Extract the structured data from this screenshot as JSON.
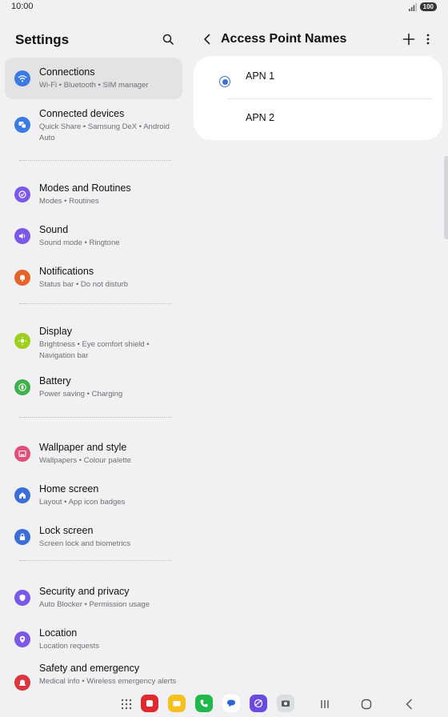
{
  "status": {
    "time": "10:00",
    "battery": "100"
  },
  "left": {
    "title": "Settings",
    "items": [
      {
        "title": "Connections",
        "subtitle": "Wi-Fi  •  Bluetooth  •  SIM manager",
        "icon": "wifi-icon",
        "color": "#3b7ae3"
      },
      {
        "title": "Connected devices",
        "subtitle": "Quick Share  •  Samsung DeX  •  Android Auto",
        "icon": "devices-icon",
        "color": "#3b7ae3"
      },
      {
        "title": "Modes and Routines",
        "subtitle": "Modes  •  Routines",
        "icon": "modes-icon",
        "color": "#7b58e8"
      },
      {
        "title": "Sound",
        "subtitle": "Sound mode  •  Ringtone",
        "icon": "speaker-icon",
        "color": "#7b58e8"
      },
      {
        "title": "Notifications",
        "subtitle": "Status bar  •  Do not disturb",
        "icon": "bell-icon",
        "color": "#e8632b"
      },
      {
        "title": "Display",
        "subtitle": "Brightness  •  Eye comfort shield  •  Navigation bar",
        "icon": "sun-icon",
        "color": "#9ccf1e"
      },
      {
        "title": "Battery",
        "subtitle": "Power saving  •  Charging",
        "icon": "battery-icon",
        "color": "#3db14a"
      },
      {
        "title": "Wallpaper and style",
        "subtitle": "Wallpapers  •  Colour palette",
        "icon": "image-icon",
        "color": "#e04f7a"
      },
      {
        "title": "Home screen",
        "subtitle": "Layout  •  App icon badges",
        "icon": "home-icon",
        "color": "#3b6fd8"
      },
      {
        "title": "Lock screen",
        "subtitle": "Screen lock and biometrics",
        "icon": "lock-icon",
        "color": "#3b6fd8"
      },
      {
        "title": "Security and privacy",
        "subtitle": "Auto Blocker  •  Permission usage",
        "icon": "shield-icon",
        "color": "#7b58e8"
      },
      {
        "title": "Location",
        "subtitle": "Location requests",
        "icon": "location-pin-icon",
        "color": "#7b58e8"
      },
      {
        "title": "Safety and emergency",
        "subtitle": "Medical info  •  Wireless emergency alerts",
        "icon": "alert-icon",
        "color": "#d9363e"
      }
    ]
  },
  "right": {
    "title": "Access Point Names",
    "apns": [
      {
        "label": "APN 1",
        "selected": true
      },
      {
        "label": "APN 2",
        "selected": false
      }
    ]
  },
  "dock": {
    "apps": [
      {
        "name": "apps-grid-icon"
      },
      {
        "name": "app-red-icon",
        "color": "#e0292f"
      },
      {
        "name": "app-folder-icon",
        "color": "#f5c020"
      },
      {
        "name": "phone-app-icon",
        "color": "#1fb84b"
      },
      {
        "name": "messages-app-icon",
        "color": "#2a64d8"
      },
      {
        "name": "internet-app-icon",
        "color": "#6a4be0"
      },
      {
        "name": "camera-app-icon",
        "color": "#555a60"
      }
    ]
  }
}
